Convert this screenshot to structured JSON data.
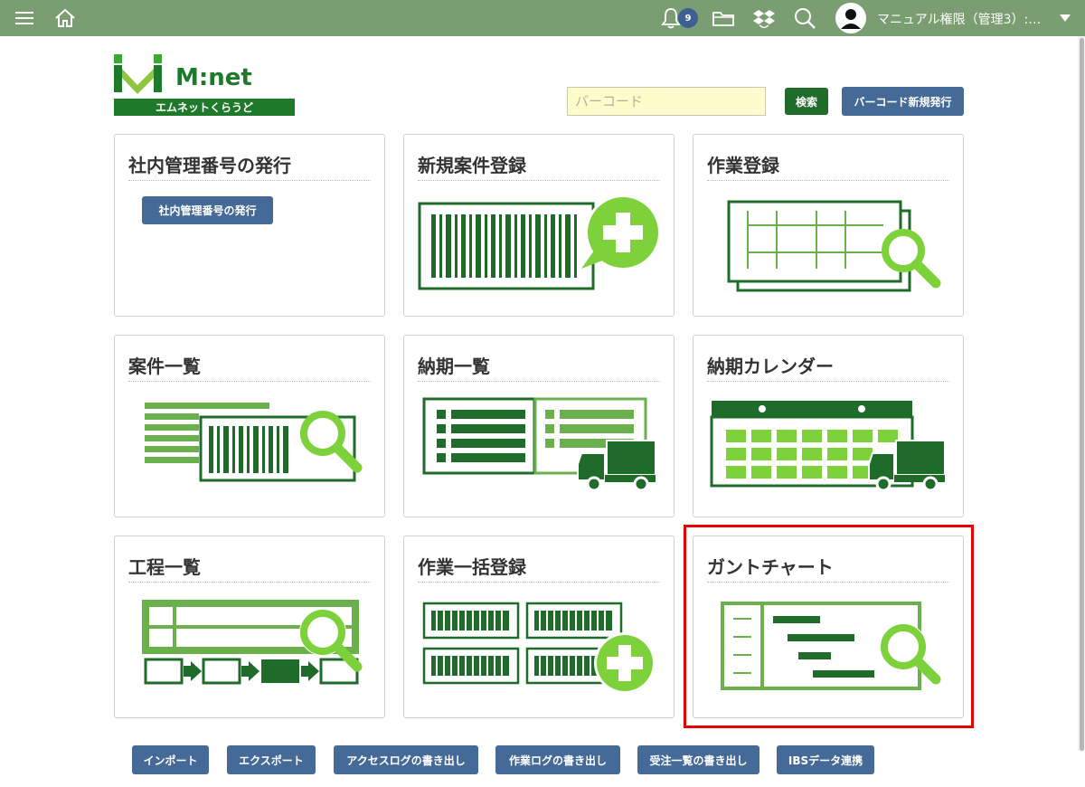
{
  "header": {
    "notification_count": "9",
    "user_name": "マニュアル権限（管理3）:…",
    "icons": [
      "menu-icon",
      "home-icon",
      "bell-icon",
      "folder-icon",
      "dropbox-icon",
      "search-icon",
      "user-avatar-icon",
      "caret-down-icon"
    ]
  },
  "logo": {
    "name": "M:net",
    "subtitle": "エムネットくらうど"
  },
  "search": {
    "placeholder": "バーコード",
    "value": "",
    "search_label": "検索",
    "new_barcode_label": "バーコード新規発行"
  },
  "cards": [
    {
      "title": "社内管理番号の発行",
      "button_label": "社内管理番号の発行"
    },
    {
      "title": "新規案件登録"
    },
    {
      "title": "作業登録"
    },
    {
      "title": "案件一覧"
    },
    {
      "title": "納期一覧"
    },
    {
      "title": "納期カレンダー"
    },
    {
      "title": "工程一覧"
    },
    {
      "title": "作業一括登録"
    },
    {
      "title": "ガントチャート"
    }
  ],
  "footer_buttons": [
    "インポート",
    "エクスポート",
    "アクセスログの書き出し",
    "作業ログの書き出し",
    "受注一覧の書き出し",
    "IBSデータ連携"
  ],
  "colors": {
    "header": "#7b9d72",
    "dark_green": "#1e6b2a",
    "light_green": "#6ab04c",
    "bright_green": "#7dd13a",
    "blue_button": "#466a98",
    "highlight": "#e60000"
  }
}
